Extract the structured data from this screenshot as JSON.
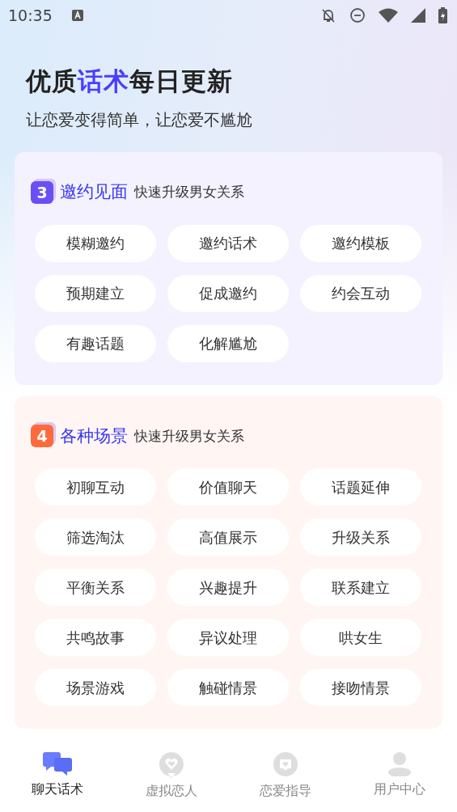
{
  "status_bar": {
    "time": "10:35"
  },
  "header": {
    "title_parts": [
      {
        "text": "优质",
        "highlight": false
      },
      {
        "text": "话术",
        "highlight": true
      },
      {
        "text": "每日更新",
        "highlight": false
      }
    ],
    "subtitle": "让恋爱变得简单，让恋爱不尴尬"
  },
  "sections": [
    {
      "number": "3",
      "color": "#6b4ff6",
      "title": "邀约见面",
      "subtitle": "快速升级男女关系",
      "kind": "invite",
      "tags": [
        "模糊邀约",
        "邀约话术",
        "邀约模板",
        "预期建立",
        "促成邀约",
        "约会互动",
        "有趣话题",
        "化解尴尬"
      ]
    },
    {
      "number": "4",
      "color": "#ff6a3d",
      "title": "各种场景",
      "subtitle": "快速升级男女关系",
      "kind": "scene",
      "tags": [
        "初聊互动",
        "价值聊天",
        "话题延伸",
        "筛选淘汰",
        "高值展示",
        "升级关系",
        "平衡关系",
        "兴趣提升",
        "联系建立",
        "共鸣故事",
        "异议处理",
        "哄女生",
        "场景游戏",
        "触碰情景",
        "接吻情景"
      ]
    }
  ],
  "tab_bar": [
    {
      "kind": "chat",
      "label": "聊天话术",
      "selected": true
    },
    {
      "kind": "heart",
      "label": "虚拟恋人",
      "selected": false
    },
    {
      "kind": "message",
      "label": "恋爱指导",
      "selected": false
    },
    {
      "kind": "user",
      "label": "用户中心",
      "selected": false
    }
  ]
}
